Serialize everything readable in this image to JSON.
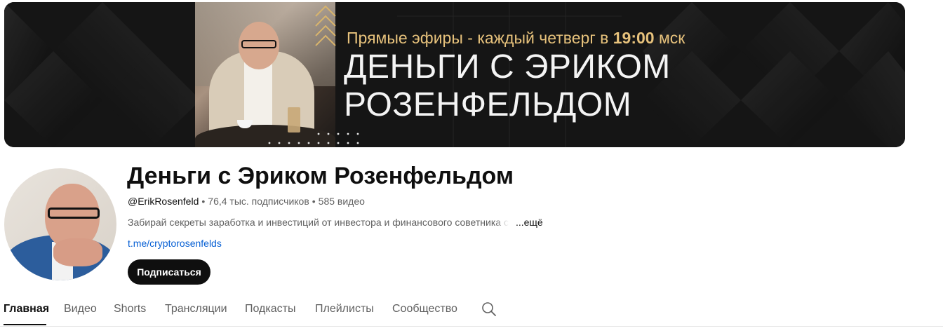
{
  "banner": {
    "subtitle_prefix": "Прямые эфиры - каждый четверг в ",
    "subtitle_time": "19:00",
    "subtitle_suffix": " мск",
    "title_line1": "ДЕНЬГИ С ЭРИКОМ",
    "title_line2": "РОЗЕНФЕЛЬДОМ"
  },
  "channel": {
    "name": "Деньги с Эриком Розенфельдом",
    "handle": "@ErikRosenfeld",
    "subscribers": "76,4 тыс. подписчиков",
    "videos": "585 видео",
    "separator": "•",
    "description": "Забирай секреты заработка и инвестиций от инвестора и финансового советника с",
    "more": "...ещё",
    "link": "t.me/cryptorosenfelds",
    "subscribe_label": "Подписаться"
  },
  "tabs": [
    {
      "label": "Главная",
      "active": true
    },
    {
      "label": "Видео"
    },
    {
      "label": "Shorts"
    },
    {
      "label": "Трансляции"
    },
    {
      "label": "Подкасты"
    },
    {
      "label": "Плейлисты"
    },
    {
      "label": "Сообщество"
    }
  ],
  "icons": {
    "search_tab": "search-icon"
  },
  "colors": {
    "subtitle_gold": "#e7c27c",
    "link_blue": "#065fd4",
    "subscribe_bg": "#0f0f0f"
  }
}
